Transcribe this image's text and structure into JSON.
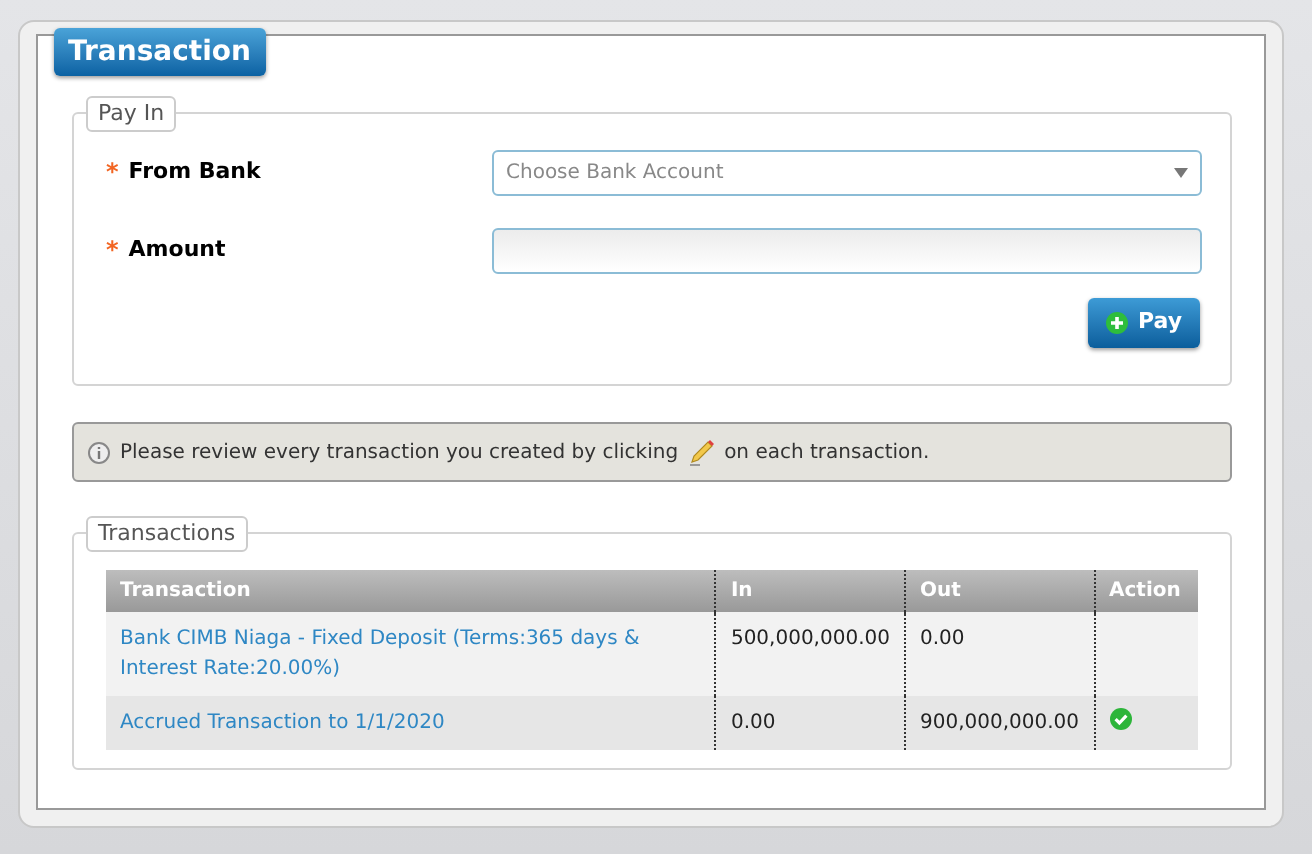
{
  "title": "Transaction",
  "pay_in": {
    "legend": "Pay In",
    "fields": [
      {
        "kind": "select",
        "label": "From Bank",
        "required_mark": "*",
        "placeholder": "Choose Bank Account"
      },
      {
        "kind": "input",
        "label": "Amount",
        "required_mark": "*"
      }
    ],
    "button": "Pay"
  },
  "notice": {
    "before": "Please review every transaction you created by clicking",
    "after": "on each transaction."
  },
  "transactions": {
    "legend": "Transactions",
    "columns": [
      "Transaction",
      "In",
      "Out",
      "Action"
    ],
    "rows": [
      {
        "transaction": "Bank CIMB Niaga - Fixed Deposit (Terms:365 days & Interest Rate:20.00%)",
        "in": "500,000,000.00",
        "out": "0.00",
        "approved": false
      },
      {
        "transaction": "Accrued Transaction to 1/1/2020",
        "in": "0.00",
        "out": "900,000,000.00",
        "approved": true
      }
    ]
  }
}
